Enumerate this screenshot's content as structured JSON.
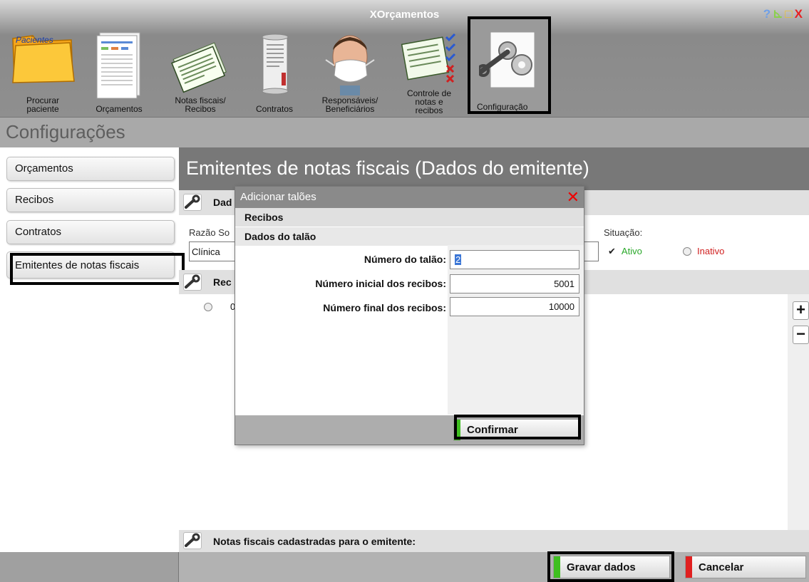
{
  "window": {
    "title": "XOrçamentos",
    "controls": {
      "help": "?",
      "minimize": "⊾",
      "maximize": "□",
      "close": "X"
    }
  },
  "toolbar": {
    "items": [
      {
        "label": "Procurar\npaciente",
        "icon": "folder-icon",
        "folder_text": "Pacientes"
      },
      {
        "label": "Orçamentos",
        "icon": "spreadsheet-icon"
      },
      {
        "label": "Notas fiscais/\nRecibos",
        "icon": "receipts-icon"
      },
      {
        "label": "Contratos",
        "icon": "scroll-icon"
      },
      {
        "label": "Responsáveis/\nBeneficiários",
        "icon": "person-mask-icon"
      },
      {
        "label": "Controle de\nnotas e\nrecibos",
        "icon": "checklist-icon"
      },
      {
        "label": "Configuração",
        "icon": "gear-wrench-icon"
      }
    ]
  },
  "section": {
    "title": "Configurações"
  },
  "sidebar": {
    "items": [
      {
        "label": "Orçamentos"
      },
      {
        "label": "Recibos"
      },
      {
        "label": "Contratos"
      },
      {
        "label": "Emitentes de notas fiscais",
        "active": true
      }
    ]
  },
  "main": {
    "title": "Emitentes de notas fiscais  (Dados do emitente)",
    "group_dados": "Dad",
    "razao_label": "Razão So",
    "razao_value": "Clínica",
    "situacao_label": "Situação:",
    "ativo_label": "Ativo",
    "inativo_label": "Inativo",
    "group_recibos": "Rec",
    "list_item_partial": "0",
    "group_notas": "Notas fiscais cadastradas para o emitente:"
  },
  "modal": {
    "title": "Adicionar talões",
    "section1": "Recibos",
    "section2": "Dados do talão",
    "fields": [
      {
        "label": "Número do talão:",
        "value": "2"
      },
      {
        "label": "Número inicial dos recibos:",
        "value": "5001"
      },
      {
        "label": "Número final dos recibos:",
        "value": "10000"
      }
    ],
    "confirm_label": "Confirmar"
  },
  "footer": {
    "save_label": "Gravar dados",
    "cancel_label": "Cancelar"
  },
  "colors": {
    "accent_green": "#3fbf20",
    "accent_red": "#e02020",
    "ativo_text": "#2aa82a",
    "inativo_text": "#d02020"
  }
}
